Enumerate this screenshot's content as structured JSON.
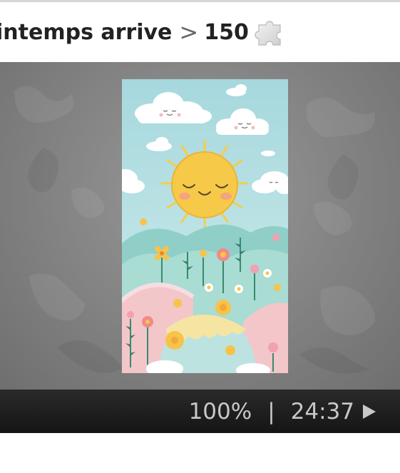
{
  "breadcrumb": {
    "title": "intemps arrive",
    "separator": ">",
    "piece_count": "150"
  },
  "icons": {
    "puzzle": "puzzle-piece-icon",
    "play": "play-icon"
  },
  "status": {
    "zoom": "100%",
    "divider": "|",
    "timer": "24:37"
  },
  "colors": {
    "stage_bg": "#888888",
    "statusbar_bg": "#1c1c1c",
    "status_text": "#c8c8c8"
  }
}
